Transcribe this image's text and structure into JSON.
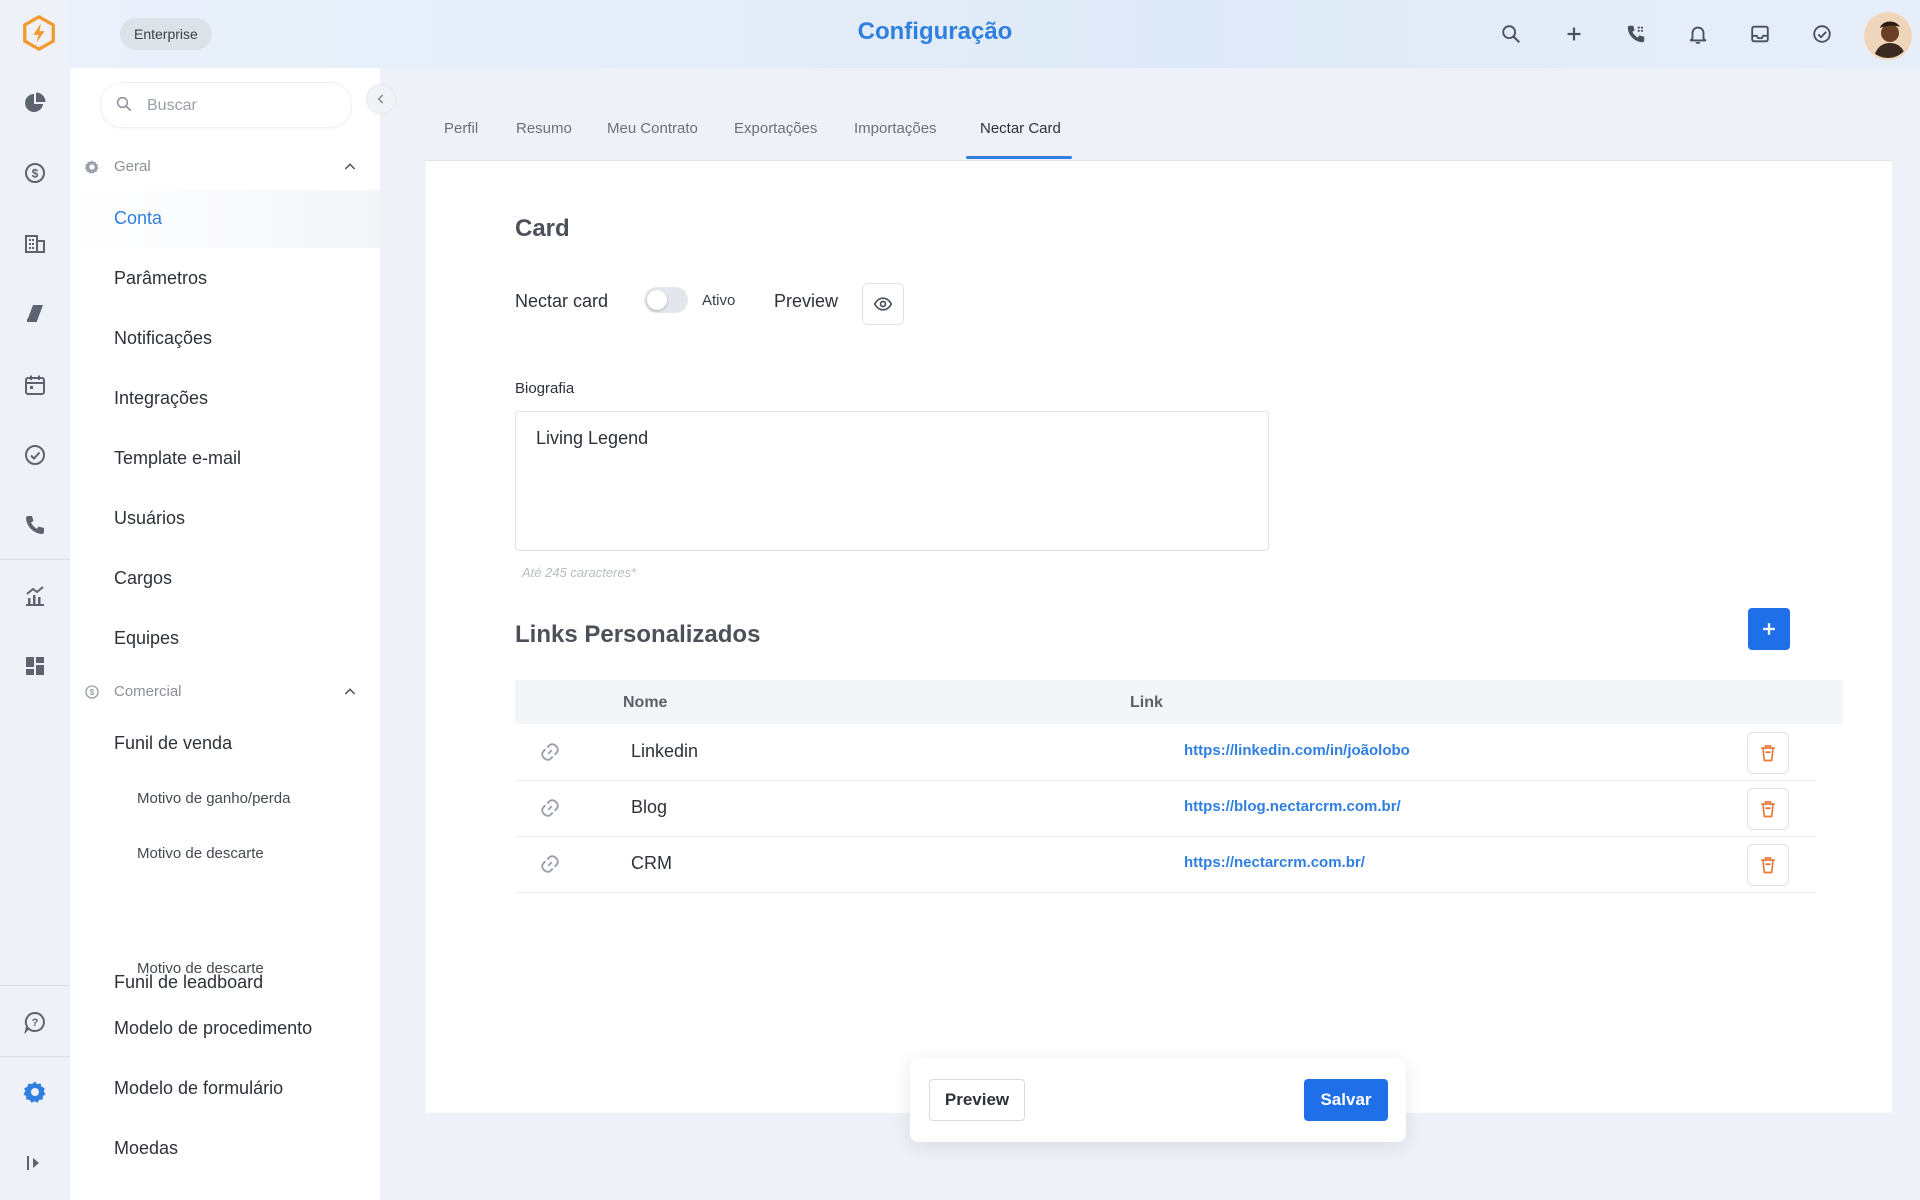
{
  "header": {
    "plan_badge": "Enterprise",
    "title": "Configuração",
    "icons": [
      "search-icon",
      "plus-icon",
      "phone-icon",
      "bell-icon",
      "inbox-icon",
      "check-circle-icon",
      "avatar"
    ]
  },
  "rail": {
    "icons": [
      "logo-icon",
      "pie-chart-icon",
      "dollar-icon",
      "building-icon",
      "megaphone-icon",
      "calendar-icon",
      "check-circle-icon",
      "phone-icon",
      "analytics-icon",
      "dashboard-icon",
      "help-icon",
      "settings-icon",
      "expand-icon"
    ]
  },
  "sidebar": {
    "search_placeholder": "Buscar",
    "sections": [
      {
        "label": "Geral",
        "items": [
          {
            "label": "Conta",
            "active": true
          },
          {
            "label": "Parâmetros"
          },
          {
            "label": "Notificações"
          },
          {
            "label": "Integrações"
          },
          {
            "label": "Template e-mail"
          },
          {
            "label": "Usuários"
          },
          {
            "label": "Cargos"
          },
          {
            "label": "Equipes"
          }
        ]
      },
      {
        "label": "Comercial",
        "items": [
          {
            "label": "Funil de venda"
          },
          {
            "label": "Motivo de ganho/perda",
            "sub": true
          },
          {
            "label": "Motivo de descarte",
            "sub": true
          },
          {
            "label": "Funil de leadboard"
          },
          {
            "label": "Motivo de descarte",
            "sub": true
          },
          {
            "label": "Modelo de procedimento"
          },
          {
            "label": "Modelo de formulário"
          },
          {
            "label": "Moedas"
          }
        ]
      }
    ]
  },
  "tabs": [
    "Perfil",
    "Resumo",
    "Meu Contrato",
    "Exportações",
    "Importações",
    "Nectar Card"
  ],
  "active_tab": "Nectar Card",
  "card": {
    "title": "Card",
    "nectar_card_label": "Nectar card",
    "toggle_label": "Ativo",
    "toggle_on": false,
    "preview_label": "Preview",
    "bio_label": "Biografia",
    "bio_value": "Living Legend",
    "bio_hint": "Até 245 caracteres*"
  },
  "links": {
    "title": "Links Personalizados",
    "columns": [
      "Nome",
      "Link"
    ],
    "rows": [
      {
        "name": "Linkedin",
        "url": "https://linkedin.com/in/joãolobo"
      },
      {
        "name": "Blog",
        "url": "https://blog.nectarcrm.com.br/"
      },
      {
        "name": "CRM",
        "url": "https://nectarcrm.com.br/"
      }
    ]
  },
  "footer": {
    "preview_label": "Preview",
    "save_label": "Salvar"
  },
  "colors": {
    "accent": "#2f7fe0",
    "primary_button": "#1f6fe8",
    "delete": "#e8793a",
    "logo": "#f29a2e"
  }
}
